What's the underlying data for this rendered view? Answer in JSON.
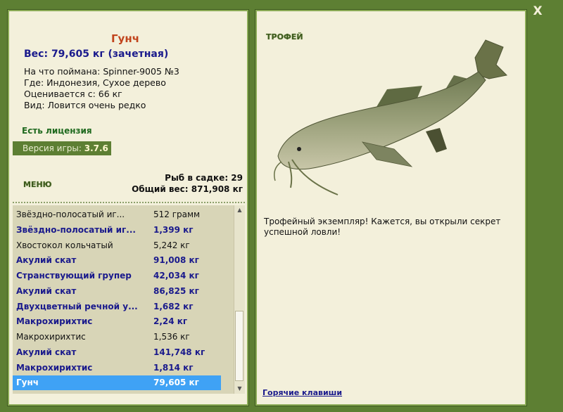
{
  "close": {
    "label": "X"
  },
  "fish": {
    "name": "Гунч",
    "weight": "Вес: 79,605 кг (зачетная)",
    "caught_with": "На что поймана: Spinner-9005 №3",
    "location": "Где: Индонезия, Сухое дерево",
    "rated_from": "Оценивается с: 66 кг",
    "kind": "Вид: Ловится очень редко"
  },
  "license": "Есть лицензия",
  "version": {
    "label": "Версия игры: ",
    "value": "3.7.6"
  },
  "menu_label": "МЕНЮ",
  "keepnet": {
    "count": "Рыб в садке: 29",
    "total": "Общий вес: 871,908 кг"
  },
  "list": [
    {
      "name": "Звёздно-полосатый иг...",
      "weight": "512 грамм",
      "style": "normal"
    },
    {
      "name": "Звёздно-полосатый иг...",
      "weight": "1,399 кг",
      "style": "trophy"
    },
    {
      "name": "Хвостокол кольчатый",
      "weight": "5,242 кг",
      "style": "normal"
    },
    {
      "name": "Акулий скат",
      "weight": "91,008 кг",
      "style": "trophy"
    },
    {
      "name": "Странствующий групер",
      "weight": "42,034 кг",
      "style": "trophy"
    },
    {
      "name": "Акулий скат",
      "weight": "86,825 кг",
      "style": "trophy"
    },
    {
      "name": "Двухцветный речной у...",
      "weight": "1,682 кг",
      "style": "trophy"
    },
    {
      "name": "Макрохирихтис",
      "weight": "2,24 кг",
      "style": "trophy"
    },
    {
      "name": "Макрохирихтис",
      "weight": "1,536 кг",
      "style": "normal"
    },
    {
      "name": "Акулий скат",
      "weight": "141,748 кг",
      "style": "trophy"
    },
    {
      "name": "Макрохирихтис",
      "weight": "1,814 кг",
      "style": "trophy"
    },
    {
      "name": "Гунч",
      "weight": "79,605 кг",
      "style": "selected"
    }
  ],
  "trophy": {
    "heading": "ТРОФЕЙ",
    "text": "Трофейный экземпляр! Кажется, вы открыли секрет успешной ловли!",
    "image_icon": "catfish-image"
  },
  "hotkeys_label": "Горячие клавиши",
  "colors": {
    "frame": "#5d7f33",
    "panel": "#f3f0db",
    "trophy_text": "#1a1a8c",
    "selected": "#3fa2f5"
  }
}
